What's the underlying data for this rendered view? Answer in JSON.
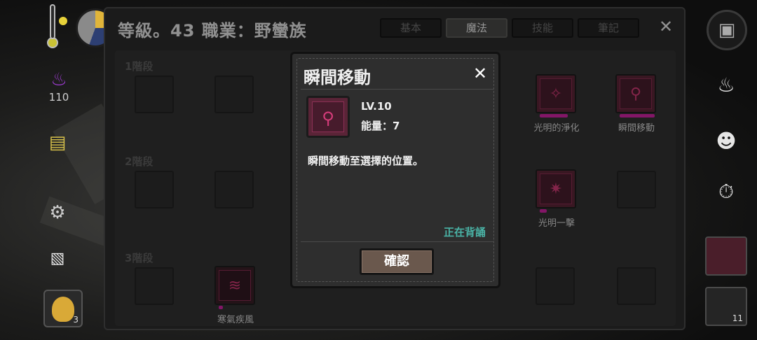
{
  "hud": {
    "fire_count": "110",
    "inventory_slot_count": "3",
    "right_slot_count": "11"
  },
  "panel": {
    "title": "等級。43 職業：野蠻族",
    "tabs": [
      {
        "label": "基本",
        "active": false
      },
      {
        "label": "魔法",
        "active": true
      },
      {
        "label": "技能",
        "active": false
      },
      {
        "label": "筆記",
        "active": false
      }
    ],
    "close_glyph": "✕",
    "stages": [
      "1階段",
      "2階段",
      "3階段"
    ],
    "skills": [
      {
        "name": "光明的淨化",
        "glyph": "✧"
      },
      {
        "name": "瞬間移動",
        "glyph": "⚲"
      },
      {
        "name": "光明一擊",
        "glyph": "✷"
      },
      {
        "name": "寒氣疾風",
        "glyph": "≋"
      }
    ]
  },
  "modal": {
    "title": "瞬間移動",
    "close_glyph": "✕",
    "icon_glyph": "⚲",
    "level": "LV.10",
    "energy": "能量：7",
    "description": "瞬間移動至選擇的位置。",
    "status": "正在背誦",
    "confirm_label": "確認"
  },
  "colors": {
    "accent_magenta": "#d324a6",
    "status_teal": "#4ab3a6",
    "confirm_bg": "#6a584d"
  }
}
